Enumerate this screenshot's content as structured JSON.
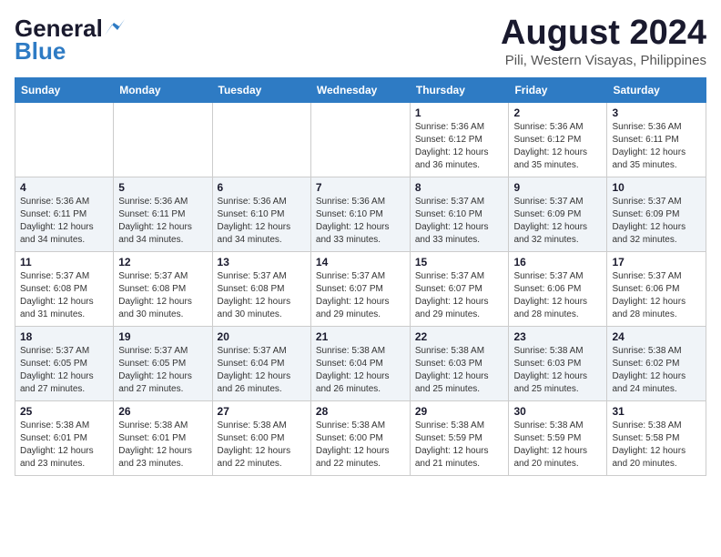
{
  "header": {
    "logo_general": "General",
    "logo_blue": "Blue",
    "month_title": "August 2024",
    "location": "Pili, Western Visayas, Philippines"
  },
  "days_of_week": [
    "Sunday",
    "Monday",
    "Tuesday",
    "Wednesday",
    "Thursday",
    "Friday",
    "Saturday"
  ],
  "weeks": [
    [
      {
        "day": "",
        "info": ""
      },
      {
        "day": "",
        "info": ""
      },
      {
        "day": "",
        "info": ""
      },
      {
        "day": "",
        "info": ""
      },
      {
        "day": "1",
        "info": "Sunrise: 5:36 AM\nSunset: 6:12 PM\nDaylight: 12 hours\nand 36 minutes."
      },
      {
        "day": "2",
        "info": "Sunrise: 5:36 AM\nSunset: 6:12 PM\nDaylight: 12 hours\nand 35 minutes."
      },
      {
        "day": "3",
        "info": "Sunrise: 5:36 AM\nSunset: 6:11 PM\nDaylight: 12 hours\nand 35 minutes."
      }
    ],
    [
      {
        "day": "4",
        "info": "Sunrise: 5:36 AM\nSunset: 6:11 PM\nDaylight: 12 hours\nand 34 minutes."
      },
      {
        "day": "5",
        "info": "Sunrise: 5:36 AM\nSunset: 6:11 PM\nDaylight: 12 hours\nand 34 minutes."
      },
      {
        "day": "6",
        "info": "Sunrise: 5:36 AM\nSunset: 6:10 PM\nDaylight: 12 hours\nand 34 minutes."
      },
      {
        "day": "7",
        "info": "Sunrise: 5:36 AM\nSunset: 6:10 PM\nDaylight: 12 hours\nand 33 minutes."
      },
      {
        "day": "8",
        "info": "Sunrise: 5:37 AM\nSunset: 6:10 PM\nDaylight: 12 hours\nand 33 minutes."
      },
      {
        "day": "9",
        "info": "Sunrise: 5:37 AM\nSunset: 6:09 PM\nDaylight: 12 hours\nand 32 minutes."
      },
      {
        "day": "10",
        "info": "Sunrise: 5:37 AM\nSunset: 6:09 PM\nDaylight: 12 hours\nand 32 minutes."
      }
    ],
    [
      {
        "day": "11",
        "info": "Sunrise: 5:37 AM\nSunset: 6:08 PM\nDaylight: 12 hours\nand 31 minutes."
      },
      {
        "day": "12",
        "info": "Sunrise: 5:37 AM\nSunset: 6:08 PM\nDaylight: 12 hours\nand 30 minutes."
      },
      {
        "day": "13",
        "info": "Sunrise: 5:37 AM\nSunset: 6:08 PM\nDaylight: 12 hours\nand 30 minutes."
      },
      {
        "day": "14",
        "info": "Sunrise: 5:37 AM\nSunset: 6:07 PM\nDaylight: 12 hours\nand 29 minutes."
      },
      {
        "day": "15",
        "info": "Sunrise: 5:37 AM\nSunset: 6:07 PM\nDaylight: 12 hours\nand 29 minutes."
      },
      {
        "day": "16",
        "info": "Sunrise: 5:37 AM\nSunset: 6:06 PM\nDaylight: 12 hours\nand 28 minutes."
      },
      {
        "day": "17",
        "info": "Sunrise: 5:37 AM\nSunset: 6:06 PM\nDaylight: 12 hours\nand 28 minutes."
      }
    ],
    [
      {
        "day": "18",
        "info": "Sunrise: 5:37 AM\nSunset: 6:05 PM\nDaylight: 12 hours\nand 27 minutes."
      },
      {
        "day": "19",
        "info": "Sunrise: 5:37 AM\nSunset: 6:05 PM\nDaylight: 12 hours\nand 27 minutes."
      },
      {
        "day": "20",
        "info": "Sunrise: 5:37 AM\nSunset: 6:04 PM\nDaylight: 12 hours\nand 26 minutes."
      },
      {
        "day": "21",
        "info": "Sunrise: 5:38 AM\nSunset: 6:04 PM\nDaylight: 12 hours\nand 26 minutes."
      },
      {
        "day": "22",
        "info": "Sunrise: 5:38 AM\nSunset: 6:03 PM\nDaylight: 12 hours\nand 25 minutes."
      },
      {
        "day": "23",
        "info": "Sunrise: 5:38 AM\nSunset: 6:03 PM\nDaylight: 12 hours\nand 25 minutes."
      },
      {
        "day": "24",
        "info": "Sunrise: 5:38 AM\nSunset: 6:02 PM\nDaylight: 12 hours\nand 24 minutes."
      }
    ],
    [
      {
        "day": "25",
        "info": "Sunrise: 5:38 AM\nSunset: 6:01 PM\nDaylight: 12 hours\nand 23 minutes."
      },
      {
        "day": "26",
        "info": "Sunrise: 5:38 AM\nSunset: 6:01 PM\nDaylight: 12 hours\nand 23 minutes."
      },
      {
        "day": "27",
        "info": "Sunrise: 5:38 AM\nSunset: 6:00 PM\nDaylight: 12 hours\nand 22 minutes."
      },
      {
        "day": "28",
        "info": "Sunrise: 5:38 AM\nSunset: 6:00 PM\nDaylight: 12 hours\nand 22 minutes."
      },
      {
        "day": "29",
        "info": "Sunrise: 5:38 AM\nSunset: 5:59 PM\nDaylight: 12 hours\nand 21 minutes."
      },
      {
        "day": "30",
        "info": "Sunrise: 5:38 AM\nSunset: 5:59 PM\nDaylight: 12 hours\nand 20 minutes."
      },
      {
        "day": "31",
        "info": "Sunrise: 5:38 AM\nSunset: 5:58 PM\nDaylight: 12 hours\nand 20 minutes."
      }
    ]
  ]
}
